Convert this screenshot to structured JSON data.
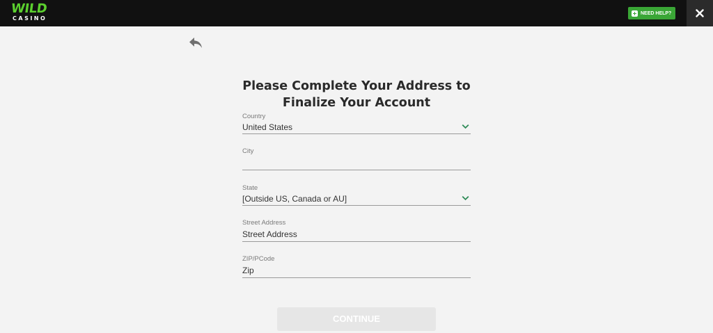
{
  "header": {
    "logo_top": "WILD",
    "logo_bottom": "CASINO",
    "help_label": "NEED HELP?",
    "help_icon": "plus-icon",
    "close_icon": "close-icon",
    "brand_color": "#5bcf2e",
    "help_button_color": "#3aa636"
  },
  "back_icon": "reply-arrow-icon",
  "form": {
    "title_line1": "Please Complete Your Address to",
    "title_line2": "Finalize Your Account",
    "country": {
      "label": "Country",
      "value": "United States"
    },
    "city": {
      "label": "City",
      "value": "",
      "placeholder": ""
    },
    "state": {
      "label": "State",
      "value": "[Outside US, Canada or AU]"
    },
    "street": {
      "label": "Street Address",
      "value": "",
      "placeholder": "Street Address"
    },
    "zip": {
      "label": "ZIP/PCode",
      "value": "",
      "placeholder": "Zip"
    },
    "dropdown_icon": "chevron-down-icon",
    "accent_color": "#2e8b57"
  },
  "continue_label": "CONTINUE"
}
